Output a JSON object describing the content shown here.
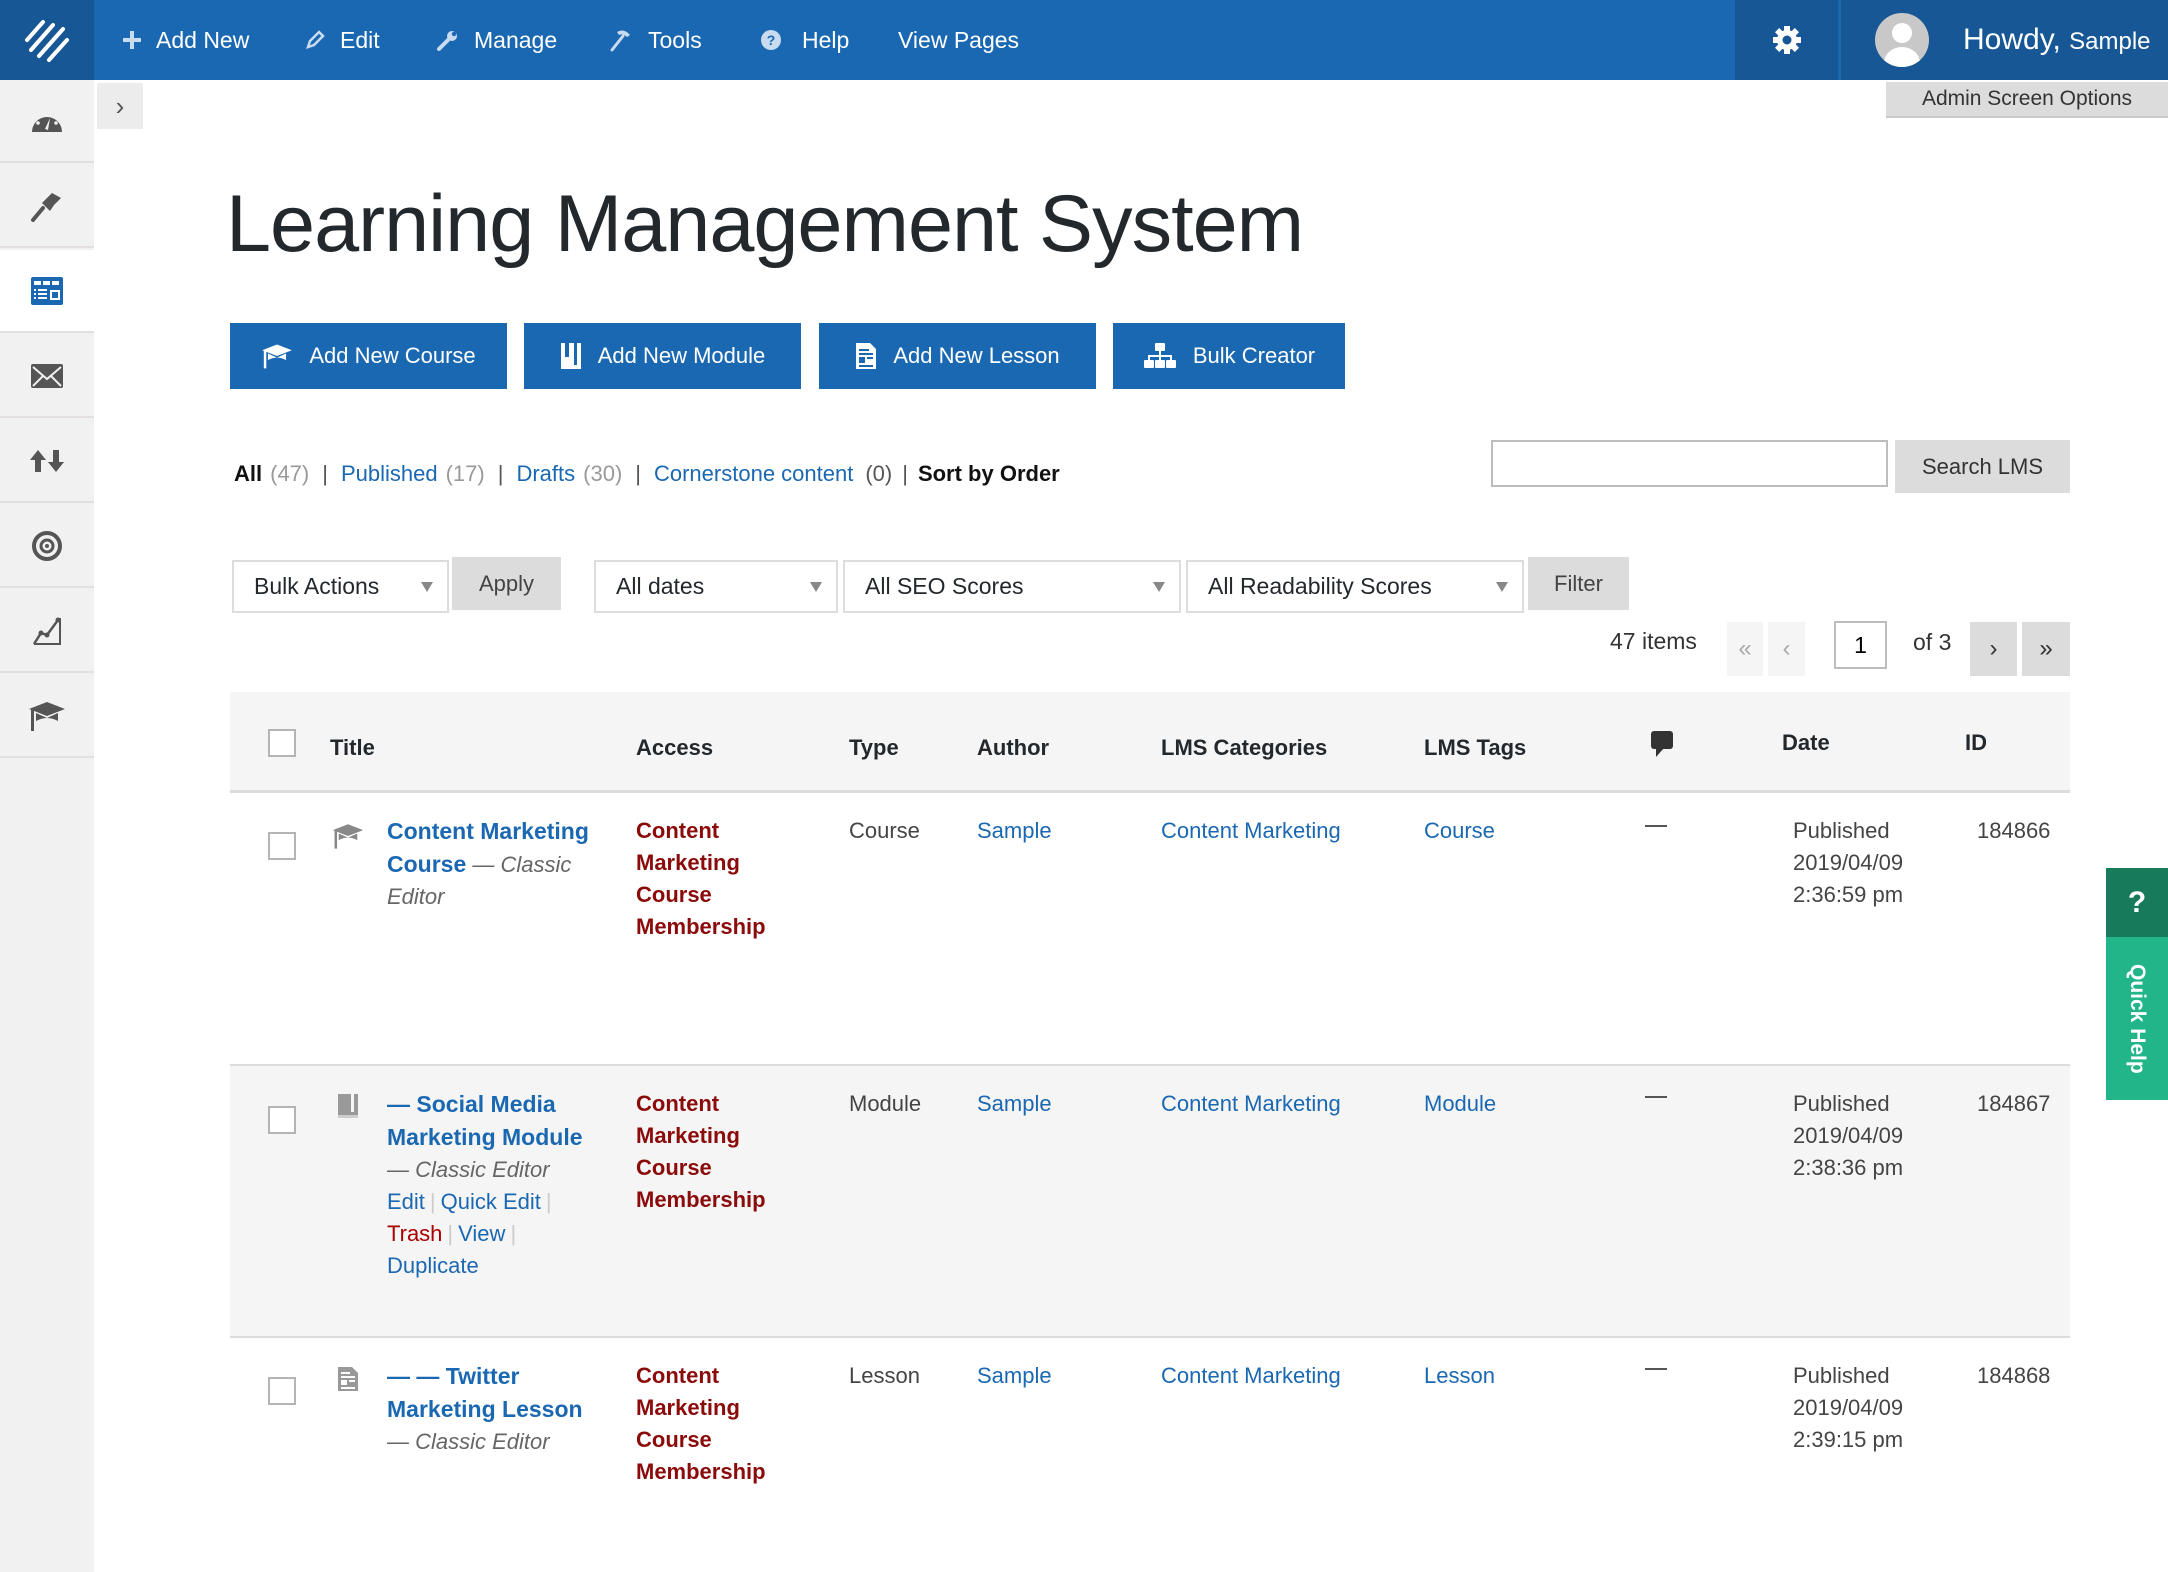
{
  "topbar": {
    "nav": [
      {
        "id": "add-new",
        "label": "Add New",
        "icon": "plus-icon"
      },
      {
        "id": "edit",
        "label": "Edit",
        "icon": "pencil-icon"
      },
      {
        "id": "manage",
        "label": "Manage",
        "icon": "wrench-icon"
      },
      {
        "id": "tools",
        "label": "Tools",
        "icon": "hammer-icon"
      },
      {
        "id": "help",
        "label": "Help",
        "icon": "question-circle-icon"
      },
      {
        "id": "view-pages",
        "label": "View Pages"
      }
    ],
    "greeting": "Howdy,",
    "username": "Sample",
    "screen_options": "Admin Screen Options"
  },
  "sidebar": {
    "items": [
      {
        "icon": "dashboard-icon"
      },
      {
        "icon": "paintbrush-icon"
      },
      {
        "icon": "lms-table-icon",
        "active": true
      },
      {
        "icon": "envelope-icon"
      },
      {
        "icon": "sort-arrows-icon"
      },
      {
        "icon": "target-icon"
      },
      {
        "icon": "analytics-chart-icon"
      },
      {
        "icon": "graduation-cap-icon"
      }
    ],
    "collapse_glyph": "›"
  },
  "page": {
    "title": "Learning Management System",
    "actions": [
      {
        "label": "Add New Course",
        "icon": "graduation-cap-icon"
      },
      {
        "label": "Add New Module",
        "icon": "book-icon"
      },
      {
        "label": "Add New Lesson",
        "icon": "document-icon"
      },
      {
        "label": "Bulk Creator",
        "icon": "sitemap-icon"
      }
    ]
  },
  "views": {
    "all": {
      "label": "All",
      "count": "(47)"
    },
    "published": {
      "label": "Published",
      "count": "(17)"
    },
    "drafts": {
      "label": "Drafts",
      "count": "(30)"
    },
    "cornerstone": {
      "label": "Cornerstone content",
      "count": "(0)"
    },
    "sort": "Sort by Order",
    "separator": "|"
  },
  "search": {
    "value": "",
    "placeholder": "",
    "button": "Search LMS"
  },
  "filters": {
    "bulk_actions": "Bulk Actions",
    "apply": "Apply",
    "dates": "All dates",
    "seo": "All SEO Scores",
    "readability": "All Readability Scores",
    "filter": "Filter"
  },
  "pagination": {
    "items": "47 items",
    "first": "«",
    "prev": "‹",
    "current": "1",
    "of": "of 3",
    "next": "›",
    "last": "»"
  },
  "table": {
    "columns": {
      "title": "Title",
      "access": "Access",
      "type": "Type",
      "author": "Author",
      "categories": "LMS Categories",
      "tags": "LMS Tags",
      "comments_icon": "comment-bubble-icon",
      "date": "Date",
      "id": "ID"
    },
    "rows": [
      {
        "icon": "graduation-cap-icon",
        "title": "Content Marketing Course",
        "editor": "— Classic Editor",
        "access": "Content Marketing Course Membership",
        "type": "Course",
        "author": "Sample",
        "category": "Content Marketing",
        "tag": "Course",
        "comments": "—",
        "status": "Published",
        "date": "2019/04/09",
        "time": "2:36:59 pm",
        "id": "184866"
      },
      {
        "icon": "book-icon",
        "title": "— Social Media Marketing Module",
        "editor": "— Classic Editor",
        "access": "Content Marketing Course Membership",
        "type": "Module",
        "author": "Sample",
        "category": "Content Marketing",
        "tag": "Module",
        "comments": "—",
        "status": "Published",
        "date": "2019/04/09",
        "time": "2:38:36 pm",
        "id": "184867",
        "actions": {
          "edit": "Edit",
          "quick_edit": "Quick Edit",
          "trash": "Trash",
          "view": "View",
          "duplicate": "Duplicate"
        }
      },
      {
        "icon": "document-icon",
        "title": "— — Twitter Marketing Lesson",
        "editor": "— Classic Editor",
        "access": "Content Marketing Course Membership",
        "type": "Lesson",
        "author": "Sample",
        "category": "Content Marketing",
        "tag": "Lesson",
        "comments": "—",
        "status": "Published",
        "date": "2019/04/09",
        "time": "2:39:15 pm",
        "id": "184868"
      }
    ]
  },
  "quick_help": {
    "glyph": "?",
    "label": "Quick Help"
  },
  "colors": {
    "brand_blue": "#1b68b2",
    "brand_dark": "#175795",
    "access_red": "#8b0a0a",
    "help_green": "#22b58a",
    "help_green_dark": "#177a5b"
  }
}
